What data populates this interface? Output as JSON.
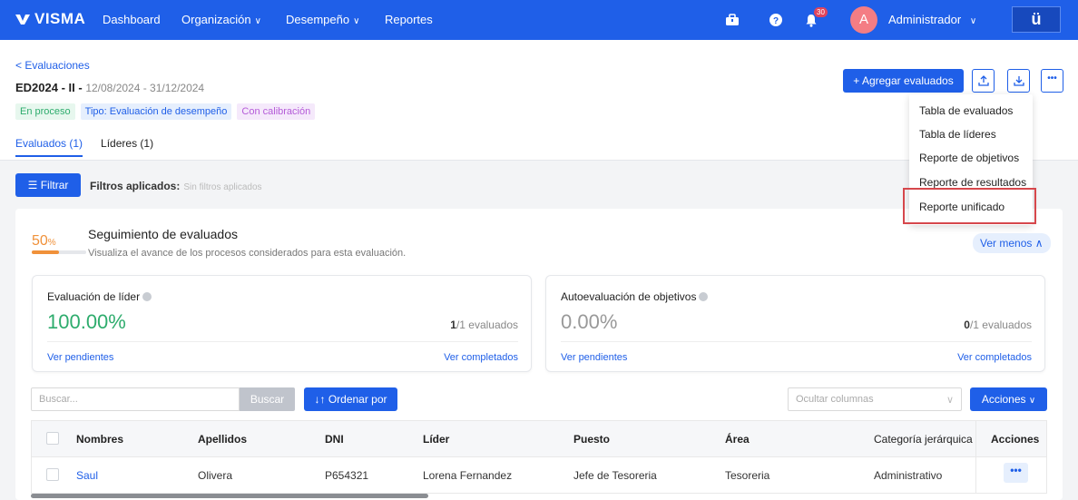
{
  "topnav": {
    "logo": "VISMA",
    "items": [
      {
        "label": "Dashboard",
        "chevron": false
      },
      {
        "label": "Organización",
        "chevron": true
      },
      {
        "label": "Desempeño",
        "chevron": true
      },
      {
        "label": "Reportes",
        "chevron": false
      }
    ],
    "notification_count": "30",
    "avatar_initial": "A",
    "user_name": "Administrador",
    "brand_button": "ü",
    "icons": [
      "briefcase-icon",
      "help-icon",
      "bell-icon"
    ]
  },
  "header": {
    "back_link": "< Evaluaciones",
    "title_code": "ED2024 - II -",
    "title_dates": "12/08/2024 - 31/12/2024",
    "tags": [
      "En proceso",
      "Tipo: Evaluación de desempeño",
      "Con calibración"
    ],
    "tabs": [
      "Evaluados (1)",
      "Líderes (1)"
    ],
    "add_button": "+ Agregar evaluados",
    "more_icon": "•••"
  },
  "dropdown": {
    "items": [
      "Tabla de evaluados",
      "Tabla de líderes",
      "Reporte de objetivos",
      "Reporte de resultados",
      "Reporte unificado"
    ]
  },
  "filters": {
    "button": "Filtrar",
    "label": "Filtros aplicados:",
    "value": "Sin filtros aplicados"
  },
  "seguimiento": {
    "percent": "50",
    "percent_sign": "%",
    "progress": 0.5,
    "title": "Seguimiento de evaluados",
    "description": "Visualiza el avance de los procesos considerados para esta evaluación.",
    "toggle": "Ver menos"
  },
  "stats": [
    {
      "title": "Evaluación de líder",
      "value": "100.00%",
      "count_num": "1",
      "count_rest": "/1 evaluados",
      "pending": "Ver pendientes",
      "completed": "Ver completados"
    },
    {
      "title": "Autoevaluación de objetivos",
      "value": "0.00%",
      "count_num": "0",
      "count_rest": "/1 evaluados",
      "pending": "Ver pendientes",
      "completed": "Ver completados"
    }
  ],
  "table_controls": {
    "search_placeholder": "Buscar...",
    "search_button": "Buscar",
    "sort_button": "Ordenar por",
    "columns_placeholder": "Ocultar columnas",
    "actions_button": "Acciones"
  },
  "table": {
    "columns": [
      "Nombres",
      "Apellidos",
      "DNI",
      "Líder",
      "Puesto",
      "Área",
      "Categoría jerárquica",
      "Acciones"
    ],
    "rows": [
      [
        "Saul",
        "Olivera",
        "P654321",
        "Lorena Fernandez",
        "Jefe de Tesoreria",
        "Tesoreria",
        "Administrativo",
        "•••"
      ]
    ]
  },
  "colors": {
    "primary": "#1f5fe8",
    "orange": "#f0913a",
    "green": "#2eac6d",
    "highlight": "#d6474c"
  }
}
